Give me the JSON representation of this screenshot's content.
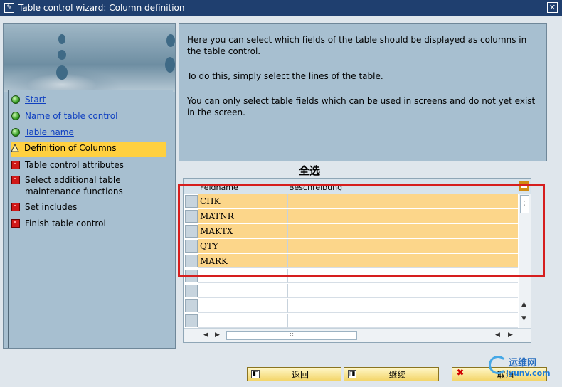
{
  "window": {
    "title": "Table control wizard: Column definition",
    "close_label": "✕"
  },
  "steps": [
    {
      "label": "Start",
      "status": "done",
      "link": true
    },
    {
      "label": "Name of table control",
      "status": "done",
      "link": true
    },
    {
      "label": "Table name",
      "status": "done",
      "link": true
    },
    {
      "label": "Definition of Columns",
      "status": "current",
      "link": false
    },
    {
      "label": "Table control attributes",
      "status": "pending",
      "link": false
    },
    {
      "label": "Select additional table maintenance functions",
      "status": "pending",
      "link": false
    },
    {
      "label": "Set includes",
      "status": "pending",
      "link": false
    },
    {
      "label": "Finish table control",
      "status": "pending",
      "link": false
    }
  ],
  "info": {
    "p1": "Here you can select which fields of the table should be displayed as columns in the table control.",
    "p2": "To do this, simply select the lines of the table.",
    "p3": "You can only select table fields which can be used in screens and do not yet exist in the screen."
  },
  "annotation": {
    "select_all": "全选"
  },
  "table": {
    "columns": [
      "Feldname",
      "Beschreibung"
    ],
    "rows": [
      {
        "field": "CHK",
        "desc": ""
      },
      {
        "field": "MATNR",
        "desc": ""
      },
      {
        "field": "MAKTX",
        "desc": ""
      },
      {
        "field": "QTY",
        "desc": ""
      },
      {
        "field": "MARK",
        "desc": ""
      }
    ]
  },
  "buttons": {
    "back": "返回",
    "continue": "继续",
    "cancel": "取消"
  },
  "watermark": {
    "line1": "运维网",
    "line2": "iyunv.com"
  },
  "colors": {
    "highlight": "#fcd68a",
    "active_step": "#ffd040",
    "annotation_red": "#d61e1e"
  }
}
